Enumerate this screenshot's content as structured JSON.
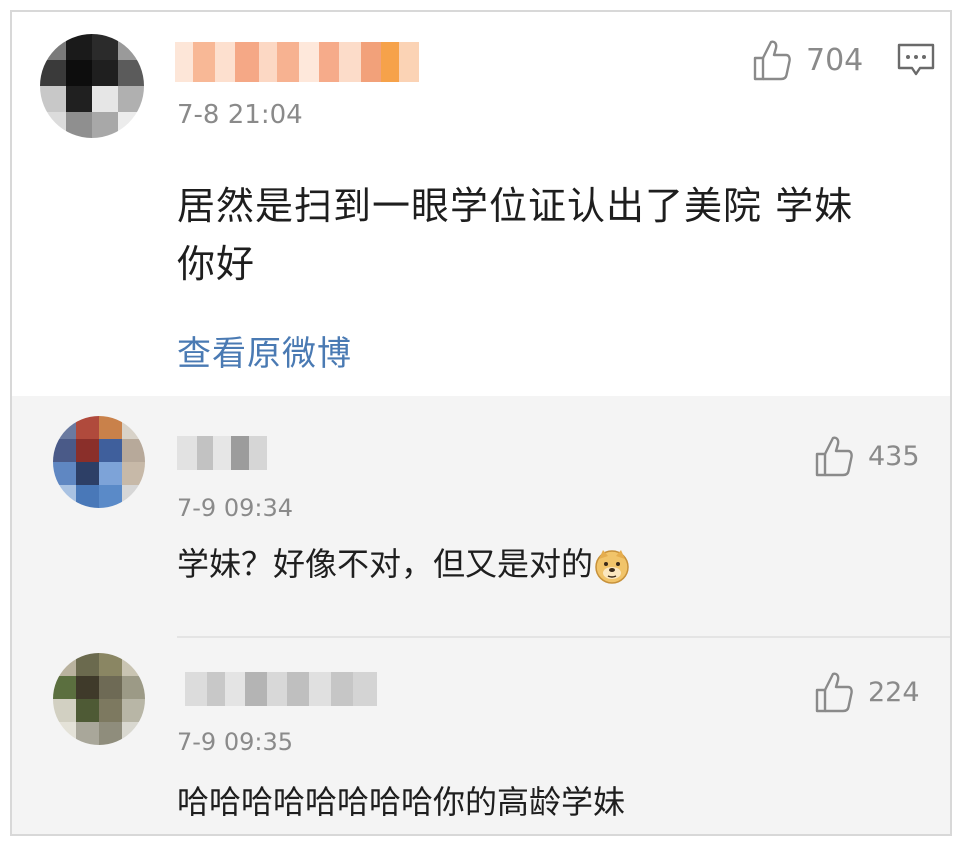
{
  "main_comment": {
    "time": "7-8 21:04",
    "like_count": "704",
    "text_line1": "居然是扫到一眼学位证认出了美院 学妹",
    "text_line2": "你好",
    "view_original_link": "查看原微博"
  },
  "replies": [
    {
      "time": "7-9 09:34",
      "like_count": "435",
      "text": "学妹？好像不对，但又是对的",
      "emoji": "doge-emoji"
    },
    {
      "time": "7-9 09:35",
      "like_count": "224",
      "text": "哈哈哈哈哈哈哈哈你的高龄学妹"
    }
  ],
  "icons": {
    "like": "thumbs-up-icon",
    "comment": "comment-icon"
  },
  "colors": {
    "link": "#4a7ab3",
    "meta_gray": "#8a8a8a",
    "reply_background": "#f4f4f4"
  }
}
